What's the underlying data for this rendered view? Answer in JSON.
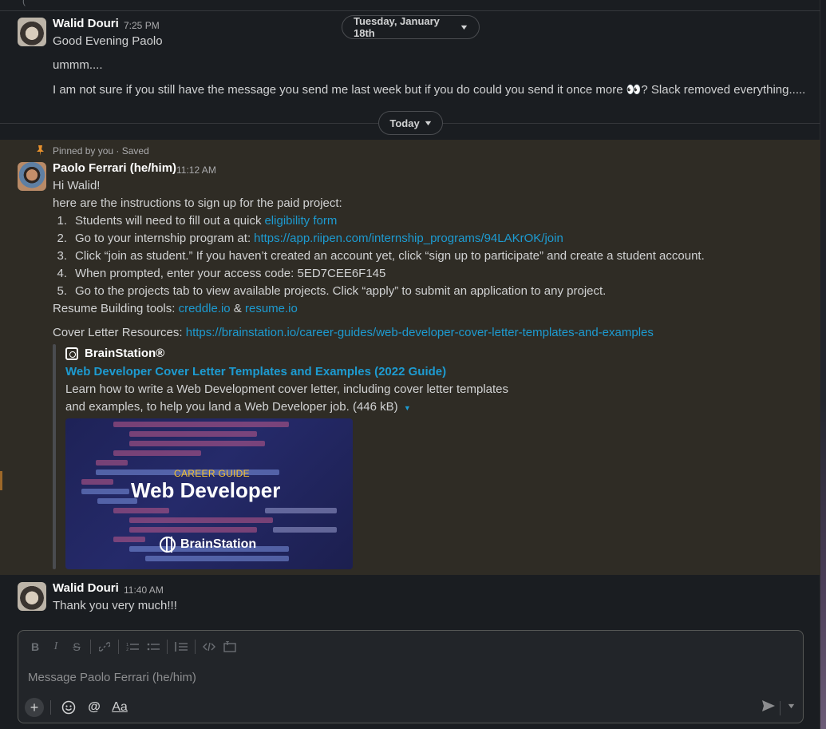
{
  "top_stub": "(",
  "dates": {
    "earlier": "Tuesday, January 18th",
    "today": "Today"
  },
  "messages": [
    {
      "author": "Walid Douri",
      "time": "7:25 PM",
      "lines": [
        "Good Evening Paolo",
        "ummm....",
        "I am not sure if you still have the message you send me last week but if you do could you send it once more 👀? Slack removed everything....."
      ]
    },
    {
      "pinned_label": "Pinned by you · Saved",
      "author": "Paolo Ferrari (he/him)",
      "time": "11:12 AM",
      "greeting": "Hi Walid!",
      "intro": "here are the instructions to sign up for the paid project:",
      "steps": [
        {
          "num": "1.",
          "text": "Students will need to fill out a quick ",
          "link": "eligibility form"
        },
        {
          "num": "2.",
          "text": "Go to your internship program at: ",
          "link": "https://app.riipen.com/internship_programs/94LAKrOK/join"
        },
        {
          "num": "3.",
          "text": "Click “join as student.” If you haven’t created an account yet, click “sign up to participate” and create a student account.",
          "link": ""
        },
        {
          "num": "4.",
          "text": "When prompted, enter your access code: 5ED7CEE6F145",
          "link": ""
        },
        {
          "num": "5.",
          "text": "Go to the projects tab to view available projects. Click “apply” to submit an application to any project.",
          "link": ""
        }
      ],
      "resume_prefix": "Resume Building tools: ",
      "resume_link1": "creddle.io",
      "resume_amp": " & ",
      "resume_link2": "resume.io",
      "cover_prefix": "Cover Letter Resources: ",
      "cover_link": "https://brainstation.io/career-guides/web-developer-cover-letter-templates-and-examples",
      "attachment": {
        "site": "BrainStation®",
        "title": "Web Developer Cover Letter Templates and Examples (2022 Guide)",
        "desc_line1": "Learn how to write a Web Development cover letter, including cover letter templates",
        "desc_line2": "and examples, to help you land a Web Developer job. (446 kB)",
        "image": {
          "tag": "CAREER GUIDE",
          "title": "Web Developer",
          "brand": "BrainStation"
        }
      }
    },
    {
      "author": "Walid Douri",
      "time": "11:40 AM",
      "lines": [
        "Thank you very much!!!"
      ]
    }
  ],
  "composer": {
    "placeholder": "Message Paolo Ferrari (he/him)",
    "format_icons": [
      "bold-icon",
      "italic-icon",
      "strikethrough-icon",
      "link-icon",
      "ordered-list-icon",
      "bulleted-list-icon",
      "blockquote-icon",
      "code-icon",
      "code-block-icon"
    ],
    "bottom_icons": [
      "plus-icon",
      "emoji-icon",
      "mention-icon",
      "text-format-icon"
    ],
    "labels": {
      "bold": "B",
      "italic": "I",
      "strike": "S",
      "mention": "@",
      "format": "Aa"
    }
  },
  "colors": {
    "background": "#1a1d21",
    "pinned_background": "#2f2c25",
    "link": "#1d9bd1",
    "pin": "#e8912d",
    "career_tag": "#f5c232"
  }
}
